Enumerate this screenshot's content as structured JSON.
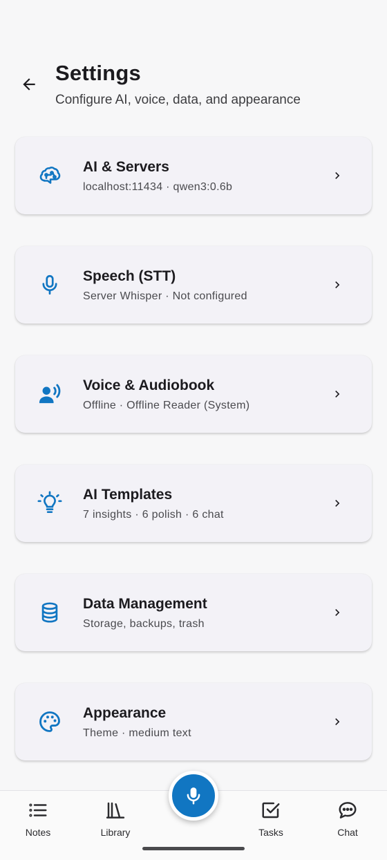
{
  "header": {
    "title": "Settings",
    "subtitle": "Configure AI, voice, data, and appearance"
  },
  "cards": [
    {
      "title": "AI & Servers",
      "subtitle": "localhost:11434 · qwen3:0.6b",
      "icon": "brain-icon"
    },
    {
      "title": "Speech (STT)",
      "subtitle": "Server Whisper · Not configured",
      "icon": "microphone-icon"
    },
    {
      "title": "Voice & Audiobook",
      "subtitle": "Offline · Offline Reader (System)",
      "icon": "voice-speaker-icon"
    },
    {
      "title": "AI Templates",
      "subtitle": "7 insights · 6 polish · 6 chat",
      "icon": "lightbulb-icon"
    },
    {
      "title": "Data Management",
      "subtitle": "Storage, backups, trash",
      "icon": "database-icon"
    },
    {
      "title": "Appearance",
      "subtitle": "Theme · medium text",
      "icon": "palette-icon"
    }
  ],
  "nav": {
    "notes": "Notes",
    "library": "Library",
    "tasks": "Tasks",
    "chat": "Chat"
  },
  "colors": {
    "accent": "#1176c2",
    "background": "#f7f7f8",
    "card": "#f3f2f7"
  }
}
